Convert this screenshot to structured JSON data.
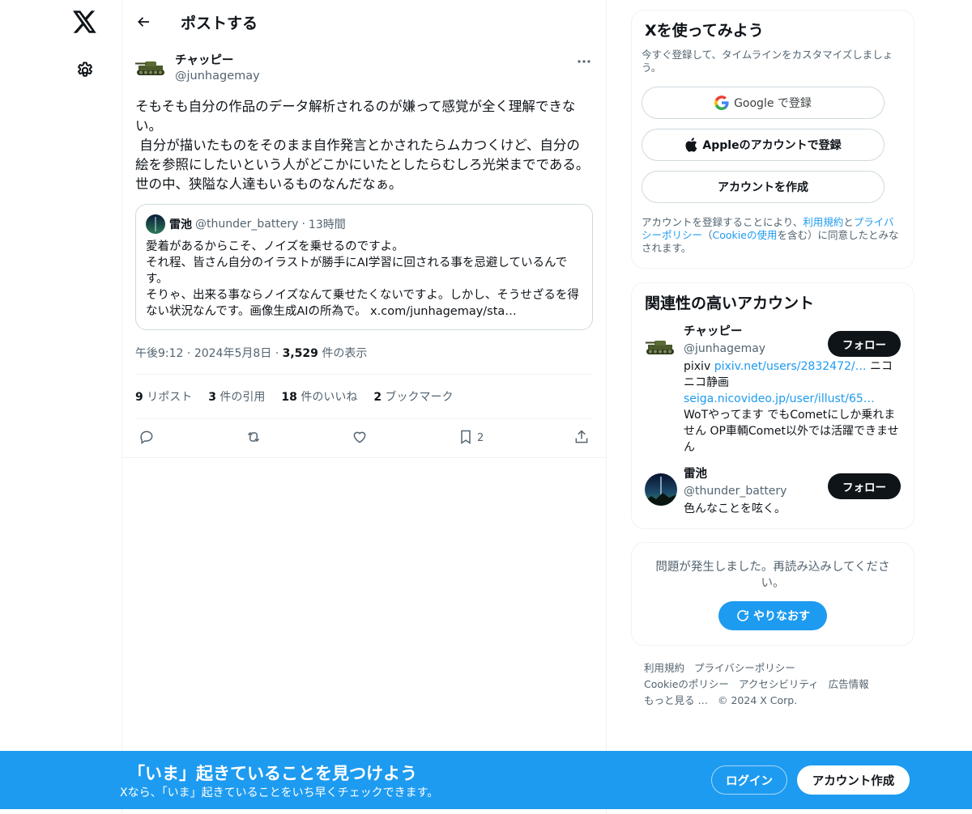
{
  "nav": {
    "logo_icon": "x-logo-icon",
    "settings_icon": "gear-icon"
  },
  "header": {
    "title": "ポストする"
  },
  "post": {
    "author_name": "チャッピー",
    "author_handle": "@junhagemay",
    "body": "そもそも自分の作品のデータ解析されるのが嫌って感覚が全く理解できない。\n 自分が描いたものをそのまま自作発言とかされたらムカつくけど、自分の絵を参照にしたいという人がどこかにいたとしたらむしろ光栄までである。\n世の中、狭隘な人達もいるものなんだなぁ。",
    "quote": {
      "name": "雷池",
      "handle": "@thunder_battery",
      "dot": "·",
      "time": "13時間",
      "body": "愛着があるからこそ、ノイズを乗せるのですよ。\nそれ程、皆さん自分のイラストが勝手にAI学習に回される事を忌避しているんです。\nそりゃ、出来る事ならノイズなんて乗せたくないですよ。しかし、そうせざるを得ない状況なんです。画像生成AIの所為で。 x.com/junhagemay/sta…"
    },
    "meta": {
      "time": "午後9:12",
      "sep1": " · ",
      "date": "2024年5月8日",
      "sep2": " · ",
      "views": "3,529",
      "views_label": " 件の表示"
    },
    "stats": [
      {
        "count": "9",
        "label": " リポスト"
      },
      {
        "count": "3",
        "label": " 件の引用"
      },
      {
        "count": "18",
        "label": " 件のいいね"
      },
      {
        "count": "2",
        "label": " ブックマーク"
      }
    ],
    "bookmark_count": "2"
  },
  "signup": {
    "title": "Xを使ってみよう",
    "subtitle": "今すぐ登録して、タイムラインをカスタマイズしましょう。",
    "google_label": "Google で登録",
    "apple_label": "Appleのアカウントで登録",
    "create_label": "アカウントを作成",
    "legal_pre": "アカウントを登録することにより、",
    "terms": "利用規約",
    "and": "と",
    "privacy": "プライバシーポリシー",
    "paren_open": "（",
    "cookie": "Cookieの使用",
    "paren_close": "を含む）に同意したとみなされます。"
  },
  "related": {
    "title": "関連性の高いアカウント",
    "accounts": [
      {
        "name": "チャッピー",
        "handle": "@junhagemay",
        "follow": "フォロー",
        "bio_pre": "pixiv ",
        "bio_link1": "pixiv.net/users/2832472/…",
        "bio_mid": " ニコニコ静画 ",
        "bio_link2": "seiga.nicovideo.jp/user/illust/65…",
        "bio_post": " WoTやってます でもCometにしか乗れません OP車輌Comet以外では活躍できません"
      },
      {
        "name": "雷池",
        "handle": "@thunder_battery",
        "follow": "フォロー",
        "bio": "色んなことを呟く。"
      }
    ]
  },
  "error": {
    "text": "問題が発生しました。再読み込みしてください。",
    "retry": "やりなおす"
  },
  "footer": {
    "links": [
      "利用規約",
      "プライバシーポリシー",
      "Cookieのポリシー",
      "アクセシビリティ",
      "広告情報",
      "もっと見る …"
    ],
    "copyright": "© 2024 X Corp."
  },
  "banner": {
    "title": "「いま」起きていることを見つけよう",
    "subtitle": "Xなら、「いま」起きていることをいち早くチェックできます。",
    "login": "ログイン",
    "create": "アカウント作成"
  },
  "colors": {
    "accent": "#1d9bf0",
    "text": "#0f1419",
    "muted": "#536471",
    "border": "#eff3f4"
  }
}
